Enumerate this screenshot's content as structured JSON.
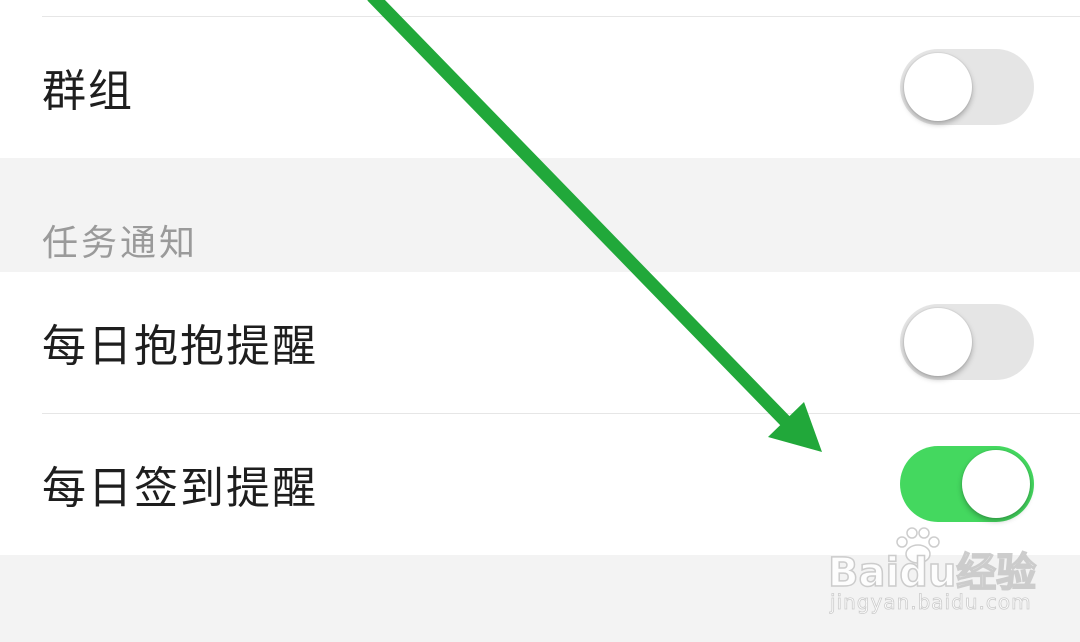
{
  "settings": {
    "rows": [
      {
        "label": "群组",
        "toggle_on": false
      },
      {
        "label": "每日抱抱提醒",
        "toggle_on": false
      },
      {
        "label": "每日签到提醒",
        "toggle_on": true
      }
    ],
    "section_header": "任务通知"
  },
  "colors": {
    "toggle_on": "#44d85f",
    "toggle_off": "#e5e5e5",
    "arrow": "#21a83a",
    "background": "#f3f3f3"
  },
  "watermark": {
    "brand": "Baidu经验",
    "url": "jingyan.baidu.com"
  }
}
